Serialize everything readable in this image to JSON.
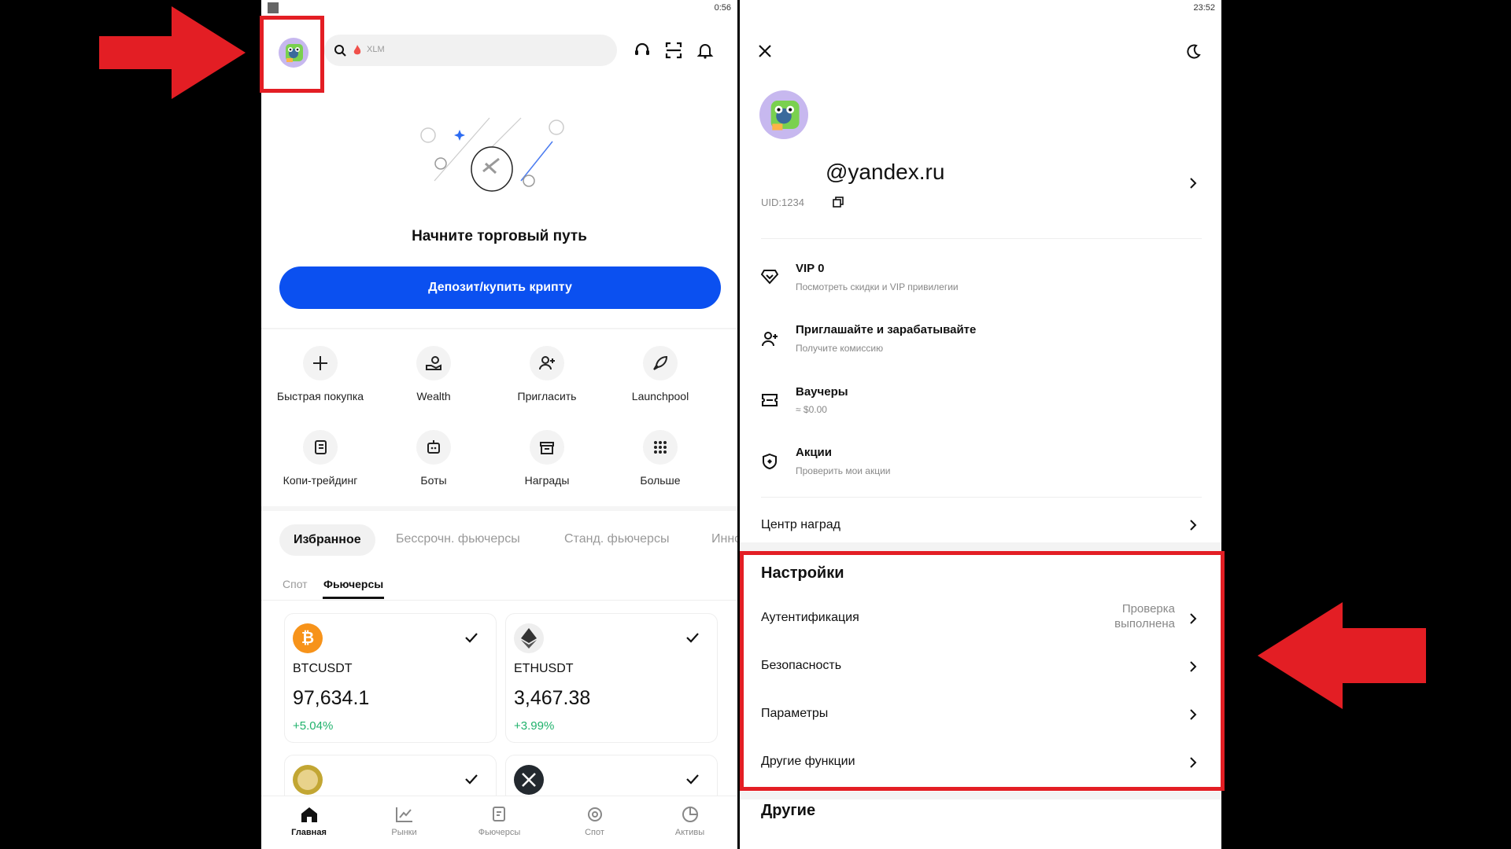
{
  "left": {
    "status_time": "0:56",
    "search_hint": "XLM",
    "hero_title": "Начните торговый путь",
    "deposit_button": "Депозит/купить крипту",
    "quick_actions": [
      {
        "label": "Быстрая покупка",
        "icon": "plus-icon"
      },
      {
        "label": "Wealth",
        "icon": "wealth-icon"
      },
      {
        "label": "Пригласить",
        "icon": "invite-icon"
      },
      {
        "label": "Launchpool",
        "icon": "rocket-icon"
      },
      {
        "label": "Копи-трейдинг",
        "icon": "copy-trading-icon"
      },
      {
        "label": "Боты",
        "icon": "bot-icon"
      },
      {
        "label": "Награды",
        "icon": "gift-icon"
      },
      {
        "label": "Больше",
        "icon": "grid-icon"
      }
    ],
    "market_tabs": [
      "Избранное",
      "Бессрочн. фьючерсы",
      "Станд. фьючерсы",
      "Инно"
    ],
    "sub_tabs": [
      "Спот",
      "Фьючерсы"
    ],
    "cards": [
      {
        "symbol": "BTCUSDT",
        "price": "97,634.1",
        "change": "+5.04%"
      },
      {
        "symbol": "ETHUSDT",
        "price": "3,467.38",
        "change": "+3.99%"
      }
    ],
    "bottom_nav": [
      "Главная",
      "Рынки",
      "Фьючерсы",
      "Спот",
      "Активы"
    ],
    "colors": {
      "accent": "#0b50f0",
      "positive": "#20b26c",
      "highlight": "#e31e24"
    }
  },
  "right": {
    "status_time": "23:52",
    "email": "@yandex.ru",
    "uid": "UID:1234",
    "menu": [
      {
        "title": "VIP 0",
        "sub": "Посмотреть скидки и VIP привилегии",
        "icon": "diamond-icon"
      },
      {
        "title": "Приглашайте и зарабатывайте",
        "sub": "Получите комиссию",
        "icon": "add-user-icon"
      },
      {
        "title": "Ваучеры",
        "sub": "≈ $0.00",
        "icon": "voucher-icon"
      },
      {
        "title": "Акции",
        "sub": "Проверить мои акции",
        "icon": "promo-icon"
      }
    ],
    "rewards_center": "Центр наград",
    "settings_heading": "Настройки",
    "settings": [
      {
        "label": "Аутентификация",
        "status": "Проверка выполнена"
      },
      {
        "label": "Безопасность",
        "status": ""
      },
      {
        "label": "Параметры",
        "status": ""
      },
      {
        "label": "Другие функции",
        "status": ""
      }
    ],
    "other_heading": "Другие"
  }
}
